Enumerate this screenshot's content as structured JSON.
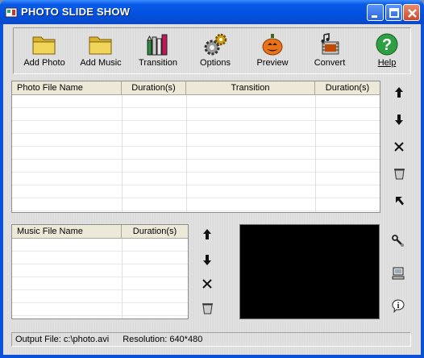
{
  "window": {
    "title": "PHOTO SLIDE SHOW",
    "accent": "#0a50d8"
  },
  "toolbar": {
    "items": [
      {
        "label": "Add Photo",
        "icon": "folder-icon"
      },
      {
        "label": "Add Music",
        "icon": "folder-icon"
      },
      {
        "label": "Transition",
        "icon": "pencils-icon"
      },
      {
        "label": "Options",
        "icon": "gears-icon"
      },
      {
        "label": "Preview",
        "icon": "pumpkin-icon"
      },
      {
        "label": "Convert",
        "icon": "film-music-icon"
      },
      {
        "label": "Help",
        "icon": "question-icon"
      }
    ]
  },
  "photo_list": {
    "columns": [
      "Photo File Name",
      "Duration(s)",
      "Transition",
      "Duration(s)"
    ],
    "rows": [],
    "side_buttons": [
      "up-arrow-icon",
      "down-arrow-icon",
      "delete-icon",
      "trash-icon",
      "pointer-icon"
    ]
  },
  "music_list": {
    "columns": [
      "Music File Name",
      "Duration(s)"
    ],
    "rows": [],
    "side_buttons": [
      "up-arrow-icon",
      "down-arrow-icon",
      "delete-icon",
      "trash-icon"
    ]
  },
  "preview_buttons": [
    "tools-icon",
    "computer-icon",
    "info-icon"
  ],
  "status": {
    "output_file": "Output File: c:\\photo.avi",
    "resolution": "Resolution: 640*480"
  }
}
